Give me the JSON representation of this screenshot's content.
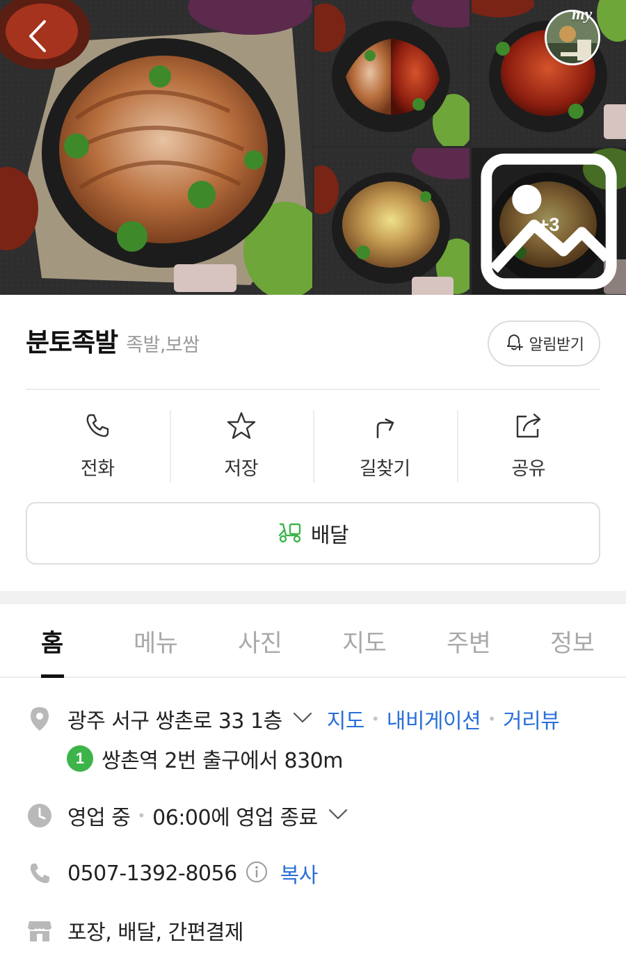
{
  "gallery": {
    "more_count": "+3",
    "my_badge": "my"
  },
  "place": {
    "name": "분토족발",
    "category": "족발,보쌈",
    "notify_label": "알림받기"
  },
  "actions": [
    {
      "label": "전화",
      "icon": "phone-icon"
    },
    {
      "label": "저장",
      "icon": "star-icon"
    },
    {
      "label": "길찾기",
      "icon": "directions-icon"
    },
    {
      "label": "공유",
      "icon": "share-icon"
    }
  ],
  "delivery": {
    "label": "배달",
    "icon": "delivery-scooter-icon"
  },
  "tabs": [
    "홈",
    "메뉴",
    "사진",
    "지도",
    "주변",
    "정보"
  ],
  "active_tab": "홈",
  "info": {
    "address": "광주 서구 쌍촌로 33 1층",
    "address_links": [
      "지도",
      "내비게이션",
      "거리뷰"
    ],
    "subway": {
      "line": "1",
      "text": "쌍촌역 2번 출구에서 830m"
    },
    "hours": {
      "status": "영업 중",
      "detail": "06:00에 영업 종료"
    },
    "phone": {
      "number": "0507-1392-8056",
      "copy_label": "복사"
    },
    "services": "포장, 배달, 간편결제"
  },
  "colors": {
    "link": "#2a6fd8",
    "subway_line_1": "#3cb44a",
    "delivery_icon": "#3cb44a",
    "icon_gray": "#b9b9b9"
  }
}
